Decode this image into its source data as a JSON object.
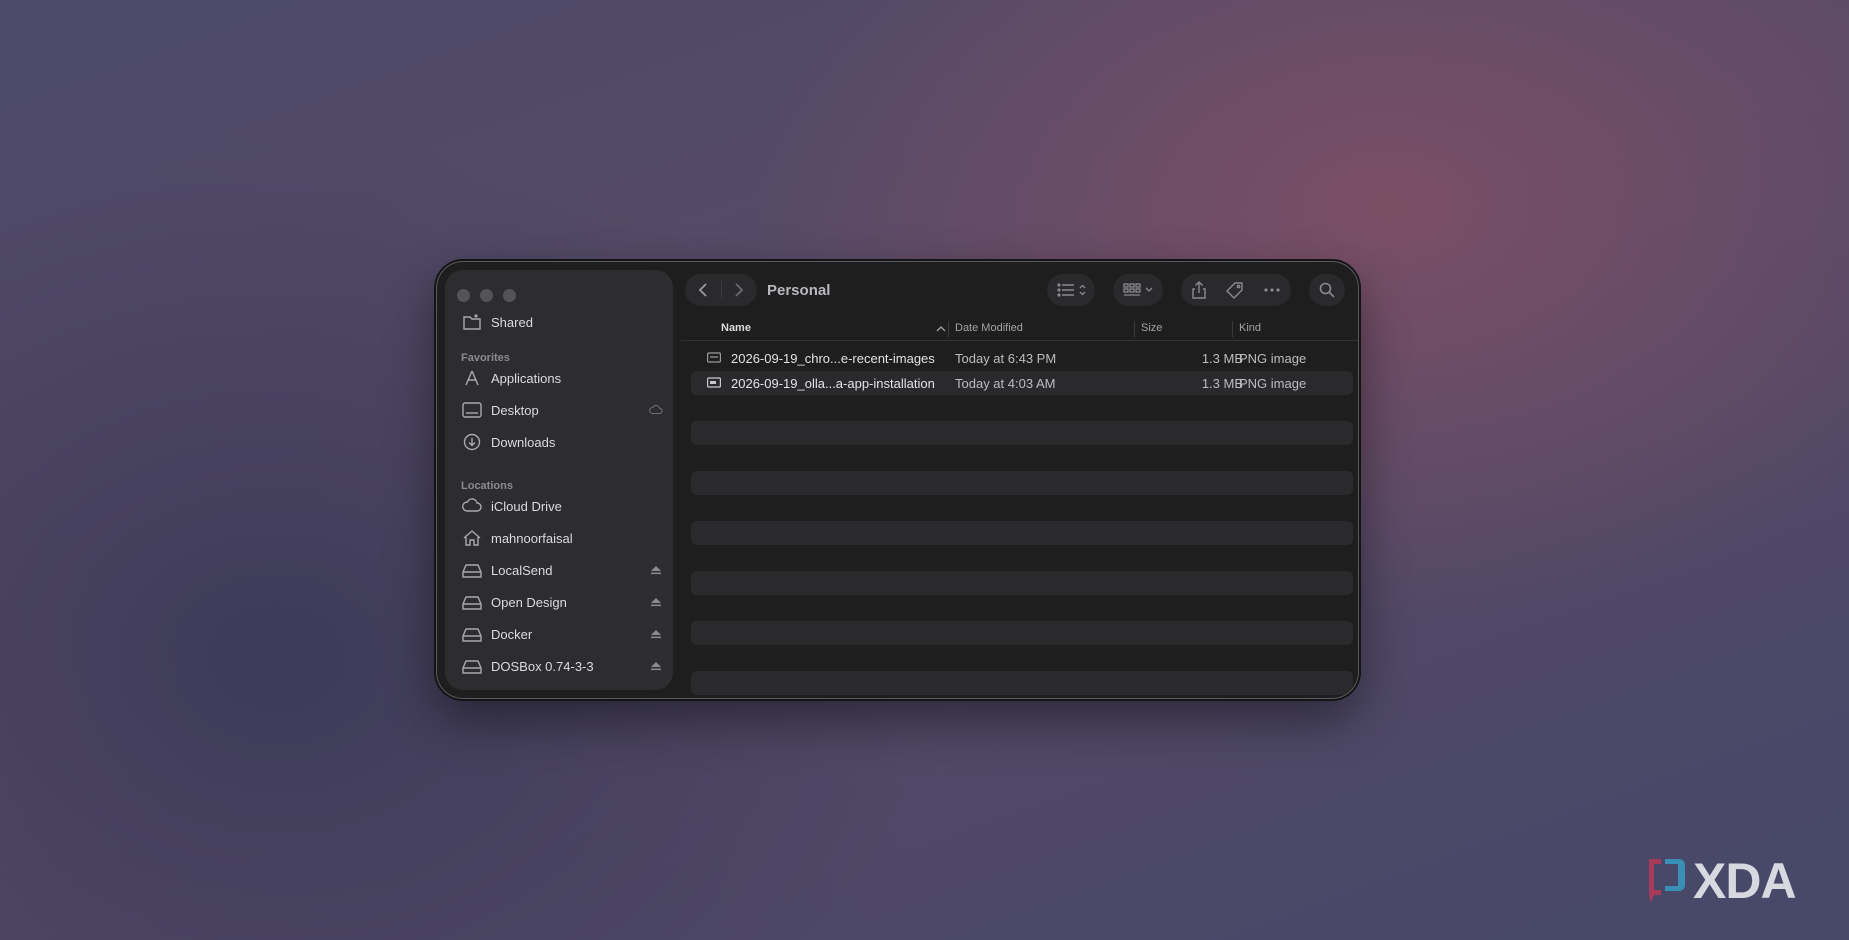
{
  "window": {
    "title": "Personal"
  },
  "sidebar": {
    "shared_label": "Shared",
    "favorites_header": "Favorites",
    "favorites": [
      {
        "label": "Applications",
        "icon": "applications-icon"
      },
      {
        "label": "Desktop",
        "icon": "desktop-icon"
      },
      {
        "label": "Downloads",
        "icon": "downloads-icon"
      }
    ],
    "locations_header": "Locations",
    "locations": [
      {
        "label": "iCloud Drive",
        "icon": "icloud-icon"
      },
      {
        "label": "mahnoorfaisal",
        "icon": "home-icon"
      },
      {
        "label": "LocalSend",
        "icon": "drive-icon"
      },
      {
        "label": "Open Design",
        "icon": "drive-icon"
      },
      {
        "label": "Docker",
        "icon": "drive-icon"
      },
      {
        "label": "DOSBox 0.74-3-3",
        "icon": "drive-icon"
      }
    ]
  },
  "columns": {
    "name": "Name",
    "date": "Date Modified",
    "size": "Size",
    "kind": "Kind"
  },
  "files": [
    {
      "name": "2026-09-19_chro...e-recent-images",
      "date": "Today at 6:43 PM",
      "size": "1.3 MB",
      "kind": "PNG image"
    },
    {
      "name": "2026-09-19_olla...a-app-installation",
      "date": "Today at 4:03 AM",
      "size": "1.3 MB",
      "kind": "PNG image"
    }
  ],
  "watermark": {
    "text": "XDA"
  },
  "colors": {
    "window_bg": "#1e1e1f",
    "sidebar_bg": "#2d2d2f",
    "text_primary": "#e3e3e6",
    "text_secondary": "#8b8b8f"
  }
}
